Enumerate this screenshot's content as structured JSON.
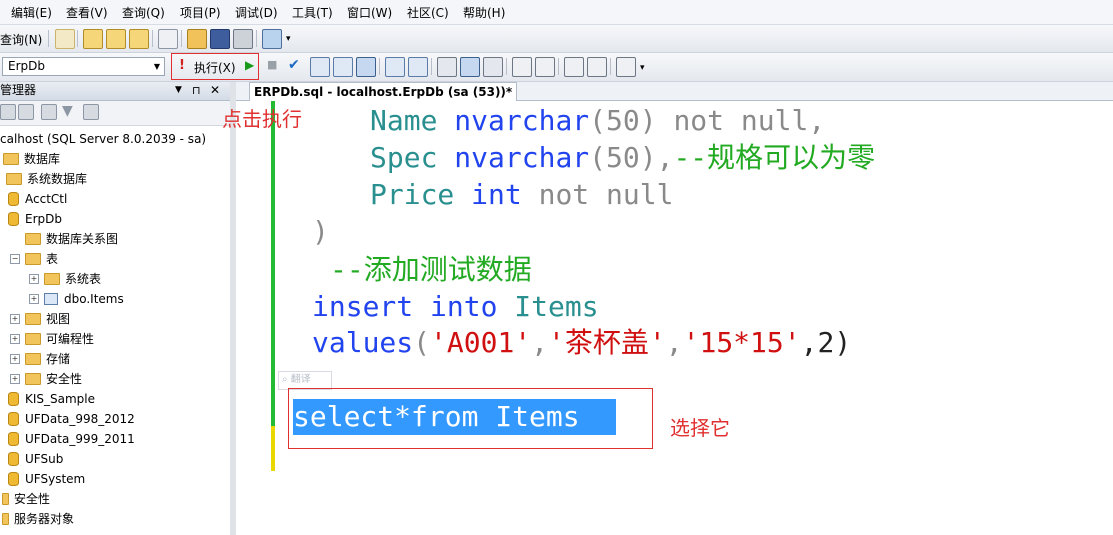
{
  "menu": [
    "编辑(E)",
    "查看(V)",
    "查询(Q)",
    "项目(P)",
    "调试(D)",
    "工具(T)",
    "窗口(W)",
    "社区(C)",
    "帮助(H)"
  ],
  "toolbar1": {
    "query_label": "查询(N)"
  },
  "toolbar2": {
    "database": "ErpDb",
    "execute_label": "执行(X)"
  },
  "object_explorer": {
    "title": "管理器",
    "tree": [
      {
        "label": "calhost (SQL Server 8.0.2039 - sa)"
      },
      {
        "label": "数据库"
      },
      {
        "label": "系统数据库"
      },
      {
        "label": "AcctCtl"
      },
      {
        "label": "ErpDb"
      },
      {
        "label": "数据库关系图"
      },
      {
        "label": "表"
      },
      {
        "label": "系统表"
      },
      {
        "label": "dbo.Items"
      },
      {
        "label": "视图"
      },
      {
        "label": "可编程性"
      },
      {
        "label": "存储"
      },
      {
        "label": "安全性"
      },
      {
        "label": "KIS_Sample"
      },
      {
        "label": "UFData_998_2012"
      },
      {
        "label": "UFData_999_2011"
      },
      {
        "label": "UFSub"
      },
      {
        "label": "UFSystem"
      },
      {
        "label": "安全性"
      },
      {
        "label": "服务器对象"
      }
    ]
  },
  "document_tab": "ERPDb.sql - localhost.ErpDb (sa (53))*",
  "code": {
    "l1_name": "Name ",
    "l1_type": "nvarchar",
    "l1_paren": "(50) ",
    "l1_rest": "not null,",
    "l2_name": "Spec ",
    "l2_type": "nvarchar",
    "l2_paren": "(50),",
    "l2_comment": "--规格可以为零",
    "l3_name": "Price ",
    "l3_type": "int",
    "l3_rest": " not null",
    "l4": ")",
    "l5_comment": "--添加测试数据",
    "l6_kw": "insert into ",
    "l6_tbl": "Items",
    "l7_kw": "values",
    "l7_p1": "(",
    "l7_s1": "'A001'",
    "l7_c1": ",",
    "l7_s2": "'茶杯盖'",
    "l7_c2": ",",
    "l7_s3": "'15*15'",
    "l7_end": ",2)",
    "selected": "select*from Items"
  },
  "ghost_hint": "翻译",
  "annotations": {
    "click_execute": "点击执行",
    "select_it": "选择它"
  }
}
